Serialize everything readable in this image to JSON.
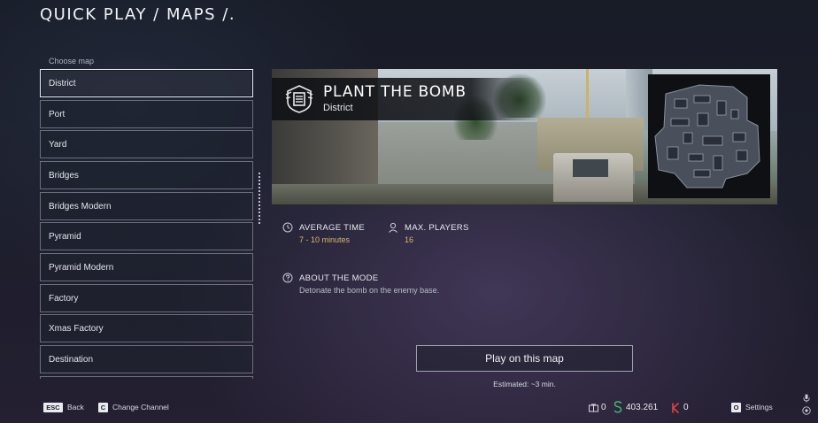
{
  "header": {
    "title": "QUICK PLAY / MAPS /."
  },
  "map_list": {
    "label": "Choose map",
    "selected": "District",
    "items": [
      "District",
      "Port",
      "Yard",
      "Bridges",
      "Bridges Modern",
      "Pyramid",
      "Pyramid Modern",
      "Factory",
      "Xmas Factory",
      "Destination"
    ]
  },
  "mode": {
    "title": "PLANT THE BOMB",
    "map_name": "District",
    "emblem_icon": "bomb-emblem-icon"
  },
  "stats": {
    "avg_time_label": "AVERAGE TIME",
    "avg_time_value": "7 - 10 minutes",
    "max_players_label": "MAX. PLAYERS",
    "max_players_value": "16"
  },
  "about": {
    "label": "ABOUT THE MODE",
    "description": "Detonate the bomb on the enemy base."
  },
  "actions": {
    "play_label": "Play on this map",
    "estimated": "Estimated: ~3 min."
  },
  "footer": {
    "esc_key": "ESC",
    "back_label": "Back",
    "c_key": "C",
    "change_channel_label": "Change Channel",
    "crowns_value": "0",
    "warbucks_value": "403.261",
    "kredits_value": "0",
    "o_key": "O",
    "settings_label": "Settings"
  },
  "colors": {
    "accent_gold": "#d9b76a",
    "warbucks_green": "#3fbf6e",
    "kredits_red": "#e0443c",
    "background": "#1c1e2b"
  }
}
